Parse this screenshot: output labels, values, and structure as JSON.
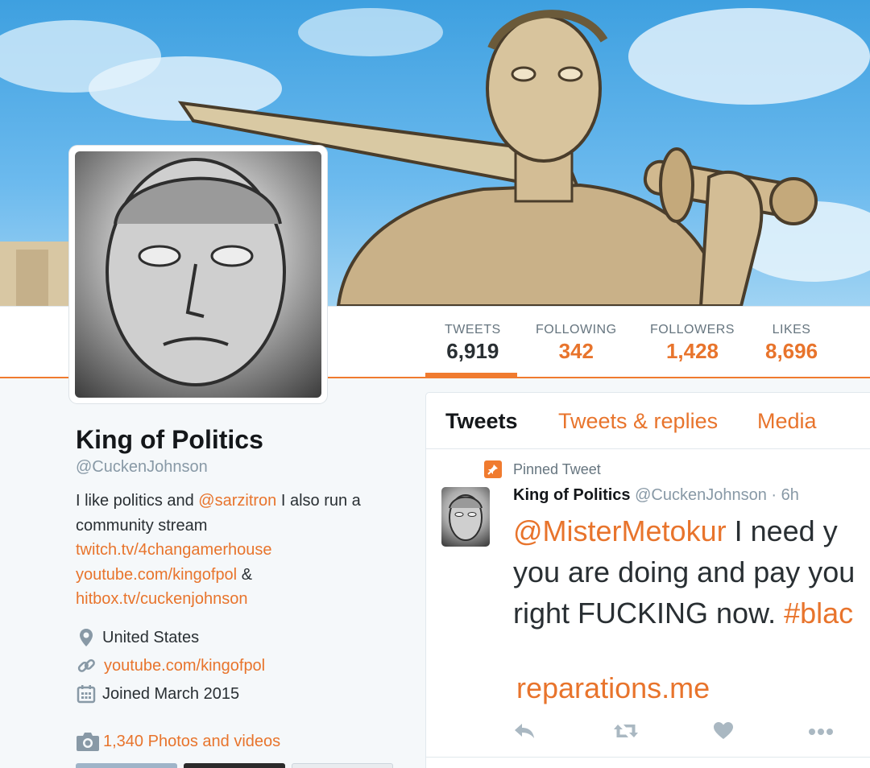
{
  "stats": [
    {
      "label": "TWEETS",
      "value": "6,919"
    },
    {
      "label": "FOLLOWING",
      "value": "342"
    },
    {
      "label": "FOLLOWERS",
      "value": "1,428"
    },
    {
      "label": "LIKES",
      "value": "8,696"
    }
  ],
  "profile": {
    "name": "King of Politics",
    "handle": "@CuckenJohnson",
    "bio": {
      "text1": "I like politics and ",
      "mention": "@sarzitron",
      "text2": " I also run a community stream",
      "link1": "twitch.tv/4changamerhouse",
      "link2": "youtube.com/kingofpol",
      "amp": " &",
      "link3": "hitbox.tv/cuckenjohnson"
    },
    "location": "United States",
    "website": "youtube.com/kingofpol",
    "joined": "Joined March 2015",
    "photos": "1,340 Photos and videos"
  },
  "timeline": {
    "tabs": [
      "Tweets",
      "Tweets & replies",
      "Media"
    ],
    "pinned_label": "Pinned Tweet",
    "tweet": {
      "name": "King of Politics",
      "handle": "@CuckenJohnson",
      "time": "· 6h",
      "mention": "@MisterMetokur",
      "line1_rest": " I need y",
      "line2": "you are doing and pay you",
      "line3_a": "right FUCKING now. ",
      "hashtag": "#blac",
      "link": "reparations.me"
    }
  },
  "colors": {
    "accent": "#e8742c",
    "text": "#292f33",
    "muted": "#8899a6"
  },
  "icons": [
    "location-icon",
    "link-icon",
    "calendar-icon",
    "camera-icon",
    "pin-icon",
    "reply-icon",
    "retweet-icon",
    "like-icon",
    "more-icon"
  ]
}
